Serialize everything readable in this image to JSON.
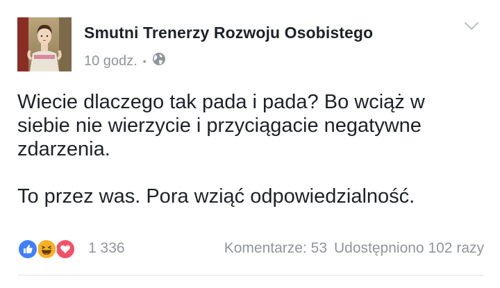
{
  "post": {
    "page_name": "Smutni Trenerzy Rozwoju Osobistego",
    "time": "10 godz.",
    "separator": "•",
    "privacy_icon": "globe-icon",
    "menu_icon": "chevron-down-icon",
    "paragraphs": [
      "Wiecie dlaczego tak pada i pada? Bo wciąż w\nsiebie nie wierzycie i przyciągacie negatywne\nzdarzenia.",
      "To przez was. Pora wziąć odpowiedzialność."
    ]
  },
  "footer": {
    "reaction_icons": [
      "like-icon",
      "haha-icon",
      "love-icon"
    ],
    "reaction_count": "1 336",
    "comments": "Komentarze: 53",
    "shares": "Udostępniono 102 razy"
  },
  "colors": {
    "like": "#4080ff",
    "haha": "#f7b125",
    "love": "#f25268",
    "secondary_text": "#90949c"
  }
}
